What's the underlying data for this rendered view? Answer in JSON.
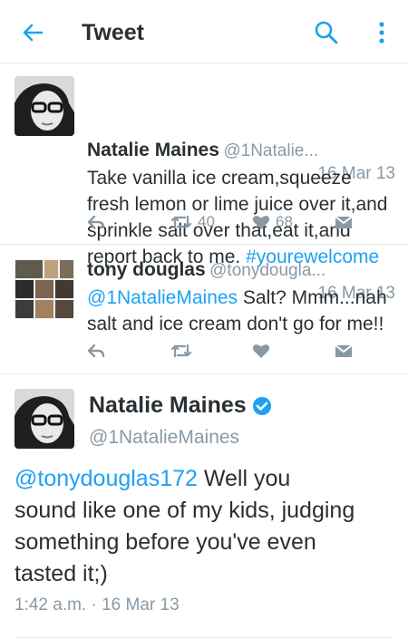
{
  "header": {
    "title": "Tweet"
  },
  "tweets": [
    {
      "name": "Natalie Maines",
      "handle": "@1Natalie...",
      "date": "16 Mar 13",
      "lines": [
        "Take vanilla ice cream,squeeze",
        "fresh lemon or lime juice over it,and",
        "sprinkle salt over that,eat it,and"
      ],
      "last_line_text": "report back to me.",
      "hashtag": "#yourewelcome",
      "retweets": "40",
      "likes": "68"
    },
    {
      "name": "tony douglas",
      "handle": "@tonydougla...",
      "date": "16 Mar 13",
      "mention": "@1NatalieMaines",
      "line1_rest": "Salt? Mmm...nah",
      "line2": "salt and ice cream don't go for me!!"
    }
  ],
  "focused": {
    "name": "Natalie Maines",
    "handle": "@1NatalieMaines",
    "mention": "@tonydouglas172",
    "text_lines": [
      "Well you",
      "sound like one of my kids, judging",
      "something before you've even",
      "tasted it;)"
    ],
    "timestamp": "1:42 a.m. · 16 Mar 13"
  },
  "colors": {
    "accent": "#1da1f2",
    "muted": "#8899a6",
    "text": "#292f33"
  }
}
